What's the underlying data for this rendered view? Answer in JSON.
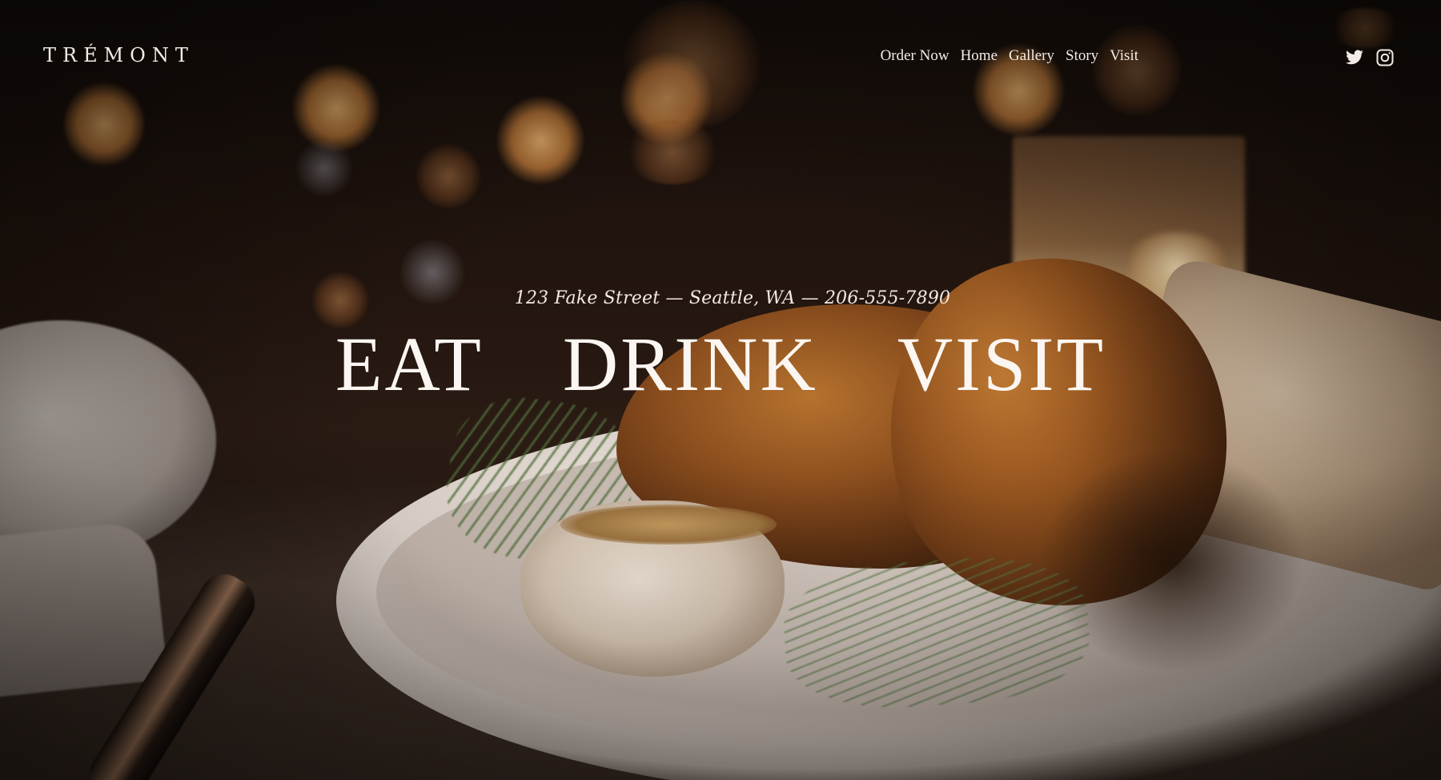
{
  "site": {
    "logo": "TRÉMONT"
  },
  "nav": {
    "items": [
      {
        "label": "Order Now"
      },
      {
        "label": "Home"
      },
      {
        "label": "Gallery"
      },
      {
        "label": "Story"
      },
      {
        "label": "Visit"
      }
    ]
  },
  "social": {
    "icons": [
      "twitter-icon",
      "instagram-icon"
    ]
  },
  "hero": {
    "address": "123 Fake Street — Seattle, WA — 206-555-7890",
    "headline_words": [
      "EAT",
      "DRINK",
      "VISIT"
    ]
  },
  "colors": {
    "text": "#f3ece6",
    "background": "#1a110c"
  }
}
